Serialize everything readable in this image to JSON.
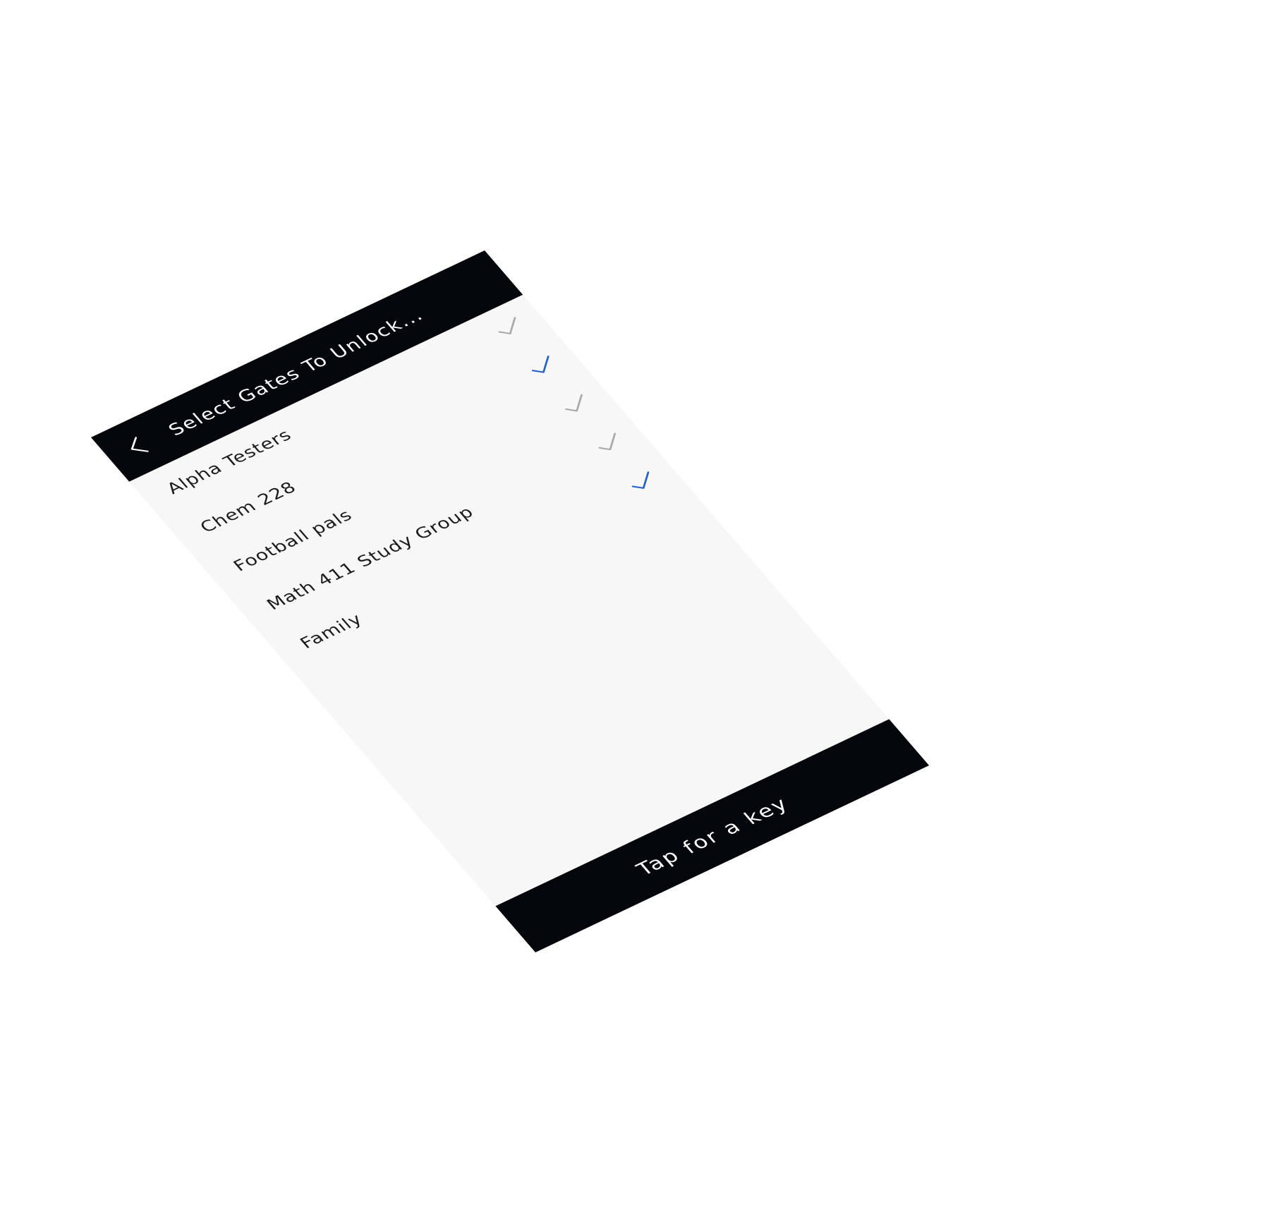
{
  "header": {
    "title": "Select Gates To Unlock...",
    "back_icon": "chevron-left-icon"
  },
  "gates": [
    {
      "label": "Alpha Testers",
      "checked": false
    },
    {
      "label": "Chem 228",
      "checked": true
    },
    {
      "label": "Football pals",
      "checked": false
    },
    {
      "label": "Math 411 Study Group",
      "checked": false
    },
    {
      "label": "Family",
      "checked": true
    }
  ],
  "footer": {
    "action_label": "Tap for a key"
  },
  "colors": {
    "bar": "#03060b",
    "list_bg": "#f7f7f7",
    "page_bg": "#ffffff",
    "text": "#1b1b1f",
    "bar_text": "#ffffff",
    "check_on": "#2462c7",
    "check_off": "#a9a9a9"
  }
}
